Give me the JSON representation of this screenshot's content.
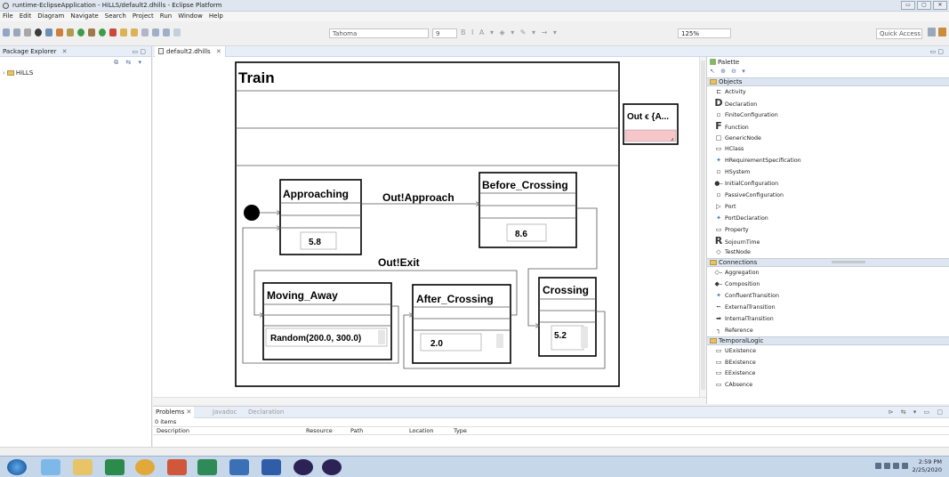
{
  "window": {
    "title": "runtime-EclipseApplication - HiLLS/default2.dhills - Eclipse Platform",
    "controls": [
      "▭",
      "▢",
      "✕"
    ]
  },
  "menu": [
    "File",
    "Edit",
    "Diagram",
    "Navigate",
    "Search",
    "Project",
    "Run",
    "Window",
    "Help"
  ],
  "toolbar": {
    "font_name": "Tahoma",
    "font_size": "9",
    "format_glyphs": "B  I  A ▾ ◈ ▾ ✎ ▾ → ▾",
    "zoom": "125%",
    "quick_access": "Quick Access"
  },
  "package_explorer": {
    "title": "Package Explorer",
    "close": "✕",
    "min_max": "▭ ▢",
    "toolbar_glyphs": "⧉ ⇆ ▾",
    "items": [
      {
        "label": "HiLLS"
      }
    ]
  },
  "editor": {
    "tab_label": "default2.dhills",
    "tab_close": "✕",
    "min_max": "▭ ▢",
    "diagram": {
      "title": "Train",
      "port_label": "Out ϵ {A...",
      "states": [
        {
          "name": "Approaching",
          "value": "5.8"
        },
        {
          "name": "Before_Crossing",
          "value": "8.6"
        },
        {
          "name": "Moving_Away",
          "value": "Random(200.0, 300.0)"
        },
        {
          "name": "After_Crossing",
          "value": "2.0"
        },
        {
          "name": "Crossing",
          "value": "5.2"
        }
      ],
      "transitions": [
        {
          "label": "Out!Approach"
        },
        {
          "label": "Out!Exit"
        }
      ]
    }
  },
  "palette": {
    "title": "Palette",
    "tool_glyphs": "↖ ⊕ ⊖ ▾",
    "drawers": [
      {
        "name": "Objects",
        "items": [
          {
            "label": "Activity",
            "icon": "activity-icon",
            "glyph": "⊏"
          },
          {
            "label": "Declaration",
            "icon": "declaration-icon",
            "glyph": "D"
          },
          {
            "label": "FiniteConfiguration",
            "icon": "finite-configuration-icon",
            "glyph": "▫"
          },
          {
            "label": "Function",
            "icon": "function-icon",
            "glyph": "F"
          },
          {
            "label": "GenericNode",
            "icon": "generic-node-icon",
            "glyph": "□"
          },
          {
            "label": "HClass",
            "icon": "hclass-icon",
            "glyph": "▭"
          },
          {
            "label": "HRequirementSpecification",
            "icon": "requirement-icon",
            "glyph": "✦"
          },
          {
            "label": "HSystem",
            "icon": "hsystem-icon",
            "glyph": "▫"
          },
          {
            "label": "InitialConfiguration",
            "icon": "initial-configuration-icon",
            "glyph": "●–"
          },
          {
            "label": "PassiveConfiguration",
            "icon": "passive-configuration-icon",
            "glyph": "▫"
          },
          {
            "label": "Port",
            "icon": "port-icon",
            "glyph": "▷"
          },
          {
            "label": "PortDeclaration",
            "icon": "port-declaration-icon",
            "glyph": "✦"
          },
          {
            "label": "Property",
            "icon": "property-icon",
            "glyph": "▭"
          },
          {
            "label": "SojournTime",
            "icon": "sojourn-time-icon",
            "glyph": "R"
          },
          {
            "label": "TestNode",
            "icon": "test-node-icon",
            "glyph": "◇"
          }
        ]
      },
      {
        "name": "Connections",
        "items": [
          {
            "label": "Aggregation",
            "icon": "aggregation-icon",
            "glyph": "◇–"
          },
          {
            "label": "Composition",
            "icon": "composition-icon",
            "glyph": "◆–"
          },
          {
            "label": "ConfluentTransition",
            "icon": "confluent-transition-icon",
            "glyph": "✦"
          },
          {
            "label": "ExternalTransition",
            "icon": "external-transition-icon",
            "glyph": "┅"
          },
          {
            "label": "InternalTransition",
            "icon": "internal-transition-icon",
            "glyph": "➡"
          },
          {
            "label": "Reference",
            "icon": "reference-icon",
            "glyph": "┐"
          }
        ]
      },
      {
        "name": "TemporalLogic",
        "items": [
          {
            "label": "UExistence",
            "icon": "uexistence-icon",
            "glyph": "▭"
          },
          {
            "label": "BExistence",
            "icon": "bexistence-icon",
            "glyph": "▭"
          },
          {
            "label": "EExistence",
            "icon": "eexistence-icon",
            "glyph": "▭"
          },
          {
            "label": "CAbsence",
            "icon": "cabsence-icon",
            "glyph": "▭"
          }
        ]
      }
    ]
  },
  "problems": {
    "tabs": [
      "Problems",
      "Javadoc",
      "Declaration"
    ],
    "close": "✕",
    "view_glyphs": "⊳ ⇆ ▾ ▭ ▢",
    "count": "0 items",
    "columns": [
      "Description",
      "Resource",
      "Path",
      "Location",
      "Type"
    ]
  },
  "taskbar": {
    "time": "2:59 PM",
    "date": "2/25/2020"
  },
  "colors": {
    "port_fill": "#f7c6c9",
    "accent": "#3a7fc4"
  }
}
